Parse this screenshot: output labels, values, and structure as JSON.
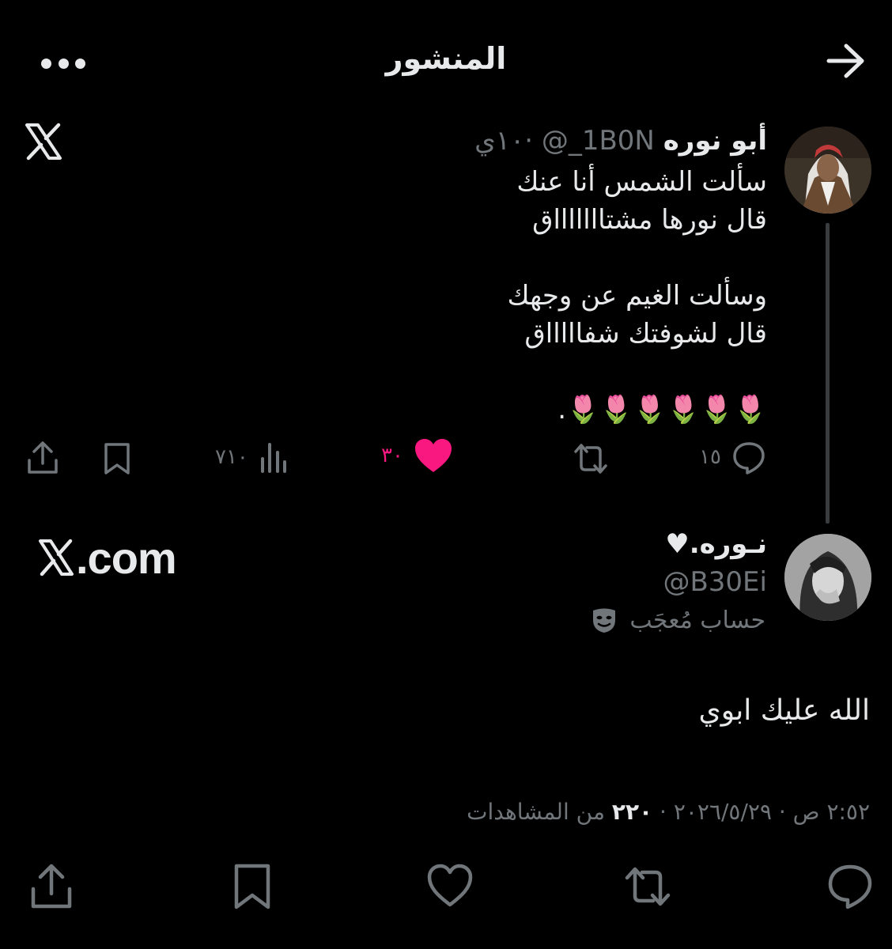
{
  "header": {
    "title": "المنشور"
  },
  "branding": {
    "xcom_text": ".com"
  },
  "quoted_tweet": {
    "author_name": "أبو نوره",
    "handle_time": "1B0N_@ ·١٠ي",
    "lines": [
      "سألت الشمس أنا عنك",
      "قال نورها مشتاااااااق",
      "",
      "وسألت الغيم عن وجهك",
      "قال لشوفتك شفاااااق",
      "",
      "🌷🌷🌷🌷🌷🌷."
    ],
    "replies": "١٥",
    "likes": "٣٠",
    "views": "٧١٠"
  },
  "main_tweet": {
    "author_name": "نـوره.♥",
    "handle": "@B30Ei",
    "badge_text": "حساب مُعجَب",
    "badge_icon": "theater-mask-icon",
    "text": "الله عليك ابوي",
    "meta_prefix": "٢:٥٢ ص · ٢٠٢٦/٥/٢٩ · ",
    "meta_views": "٢٢٠",
    "meta_suffix": " من المشاهدات"
  },
  "colors": {
    "background": "#000000",
    "text": "#e7e9ea",
    "muted": "#71767b",
    "like": "#f91880"
  }
}
